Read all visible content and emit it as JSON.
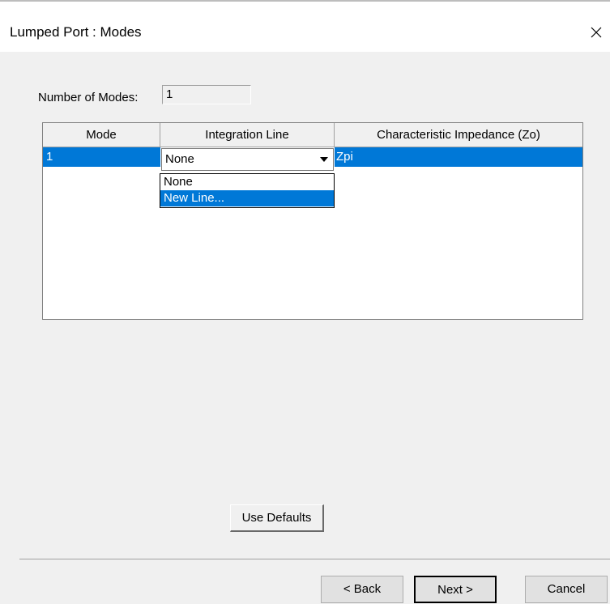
{
  "window": {
    "title": "Lumped Port : Modes",
    "close_glyph": "✕"
  },
  "modes": {
    "label": "Number of Modes:",
    "value": "1"
  },
  "table": {
    "columns": [
      "Mode",
      "Integration Line",
      "Characteristic Impedance (Zo)"
    ],
    "rows": [
      {
        "mode": "1",
        "integration_line": "None",
        "impedance": "Zpi"
      }
    ]
  },
  "dropdown": {
    "selected": "None",
    "options": [
      "None",
      "New Line..."
    ],
    "highlighted_option": "New Line..."
  },
  "buttons": {
    "use_defaults": "Use Defaults",
    "back": "< Back",
    "next": "Next >",
    "cancel": "Cancel"
  },
  "colors": {
    "selection": "#0078d7",
    "dialog_bg": "#f0f0f0"
  }
}
